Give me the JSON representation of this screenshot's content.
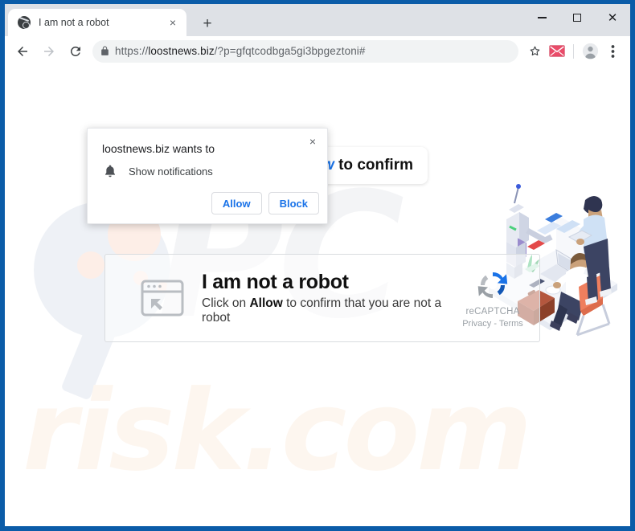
{
  "window": {
    "controls": {
      "minimize": "minimize-icon",
      "maximize": "maximize-icon",
      "close": "close-icon"
    }
  },
  "tabs": [
    {
      "title": "I am not a robot",
      "favicon": "globe-icon",
      "close_label": "×"
    }
  ],
  "newtab_label": "+",
  "toolbar": {
    "back": "back-arrow-icon",
    "forward": "forward-arrow-icon",
    "reload": "reload-icon",
    "lock": "lock-icon",
    "url_scheme": "https://",
    "url_host": "loostnews.biz",
    "url_path": "/?p=gfqtcodbga5gi3bpgeztoni#",
    "url_full": "https://loostnews.biz/?p=gfqtcodbga5gi3bpgeztoni#",
    "bookmark": "star-icon",
    "extension": "envelope-icon",
    "profile": "avatar-icon",
    "menu": "three-dot-menu-icon"
  },
  "popup": {
    "title": "loostnews.biz wants to",
    "permission_icon": "bell-icon",
    "permission": "Show notifications",
    "allow_label": "Allow",
    "block_label": "Block",
    "close_label": "×"
  },
  "page": {
    "banner": {
      "prefix": "w",
      "text": " to confirm"
    },
    "captcha": {
      "icon": "browser-window-cursor-icon",
      "title": "I am not a robot",
      "subtitle_before": "Click on ",
      "subtitle_bold": "Allow",
      "subtitle_after": " to confirm that you are not a robot",
      "recaptcha_logo": "recaptcha-icon",
      "recaptcha_name": "reCAPTCHA",
      "recaptcha_links": "Privacy - Terms"
    },
    "watermark_pc": "PC",
    "watermark_risk": "risk.com",
    "illustration": "office-robot-illustration"
  },
  "colors": {
    "window_border": "#0b5ca8",
    "tabstrip": "#dee1e6",
    "accent_blue": "#1a73e8",
    "omnibox": "#f1f3f4",
    "extension_red": "#ea4335",
    "watermark_gray": "#f3f4f6",
    "watermark_cream": "#fdf6ef"
  }
}
